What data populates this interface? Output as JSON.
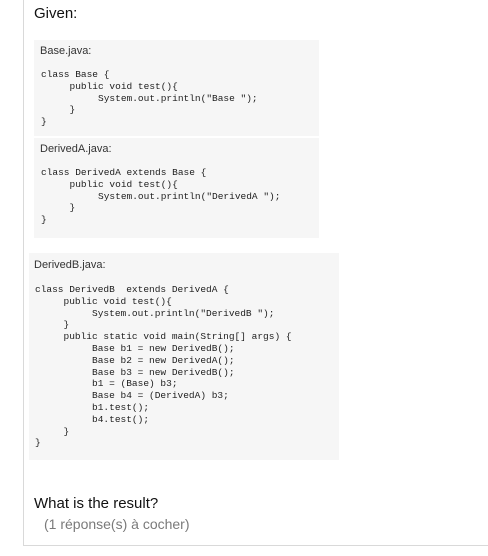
{
  "intro": "Given:",
  "files": [
    {
      "name": "Base.java:",
      "code": "class Base {\n     public void test(){\n          System.out.println(\"Base \");\n     }\n}"
    },
    {
      "name": "DerivedA.java:",
      "code": "class DerivedA extends Base {\n     public void test(){\n          System.out.println(\"DerivedA \");\n     }\n}"
    },
    {
      "name": "DerivedB.java:",
      "code": "class DerivedB  extends DerivedA {\n     public void test(){\n          System.out.println(\"DerivedB \");\n     }\n     public static void main(String[] args) {\n          Base b1 = new DerivedB();\n          Base b2 = new DerivedA();\n          Base b3 = new DerivedB();\n          b1 = (Base) b3;\n          Base b4 = (DerivedA) b3;\n          b1.test();\n          b4.test();\n     }\n}"
    }
  ],
  "question": "What is the result?",
  "instruction": "(1 réponse(s) à cocher)"
}
